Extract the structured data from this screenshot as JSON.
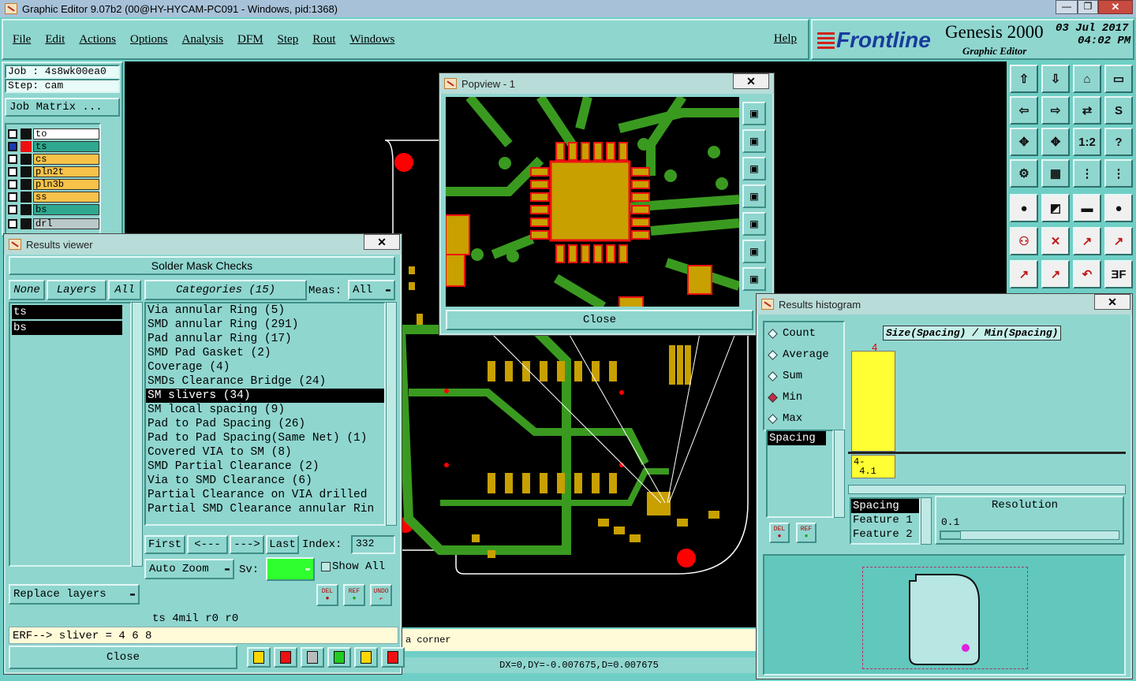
{
  "window": {
    "title": "Graphic Editor 9.07b2 (00@HY-HYCAM-PC091 - Windows, pid:1368)"
  },
  "menu": [
    "File",
    "Edit",
    "Actions",
    "Options",
    "Analysis",
    "DFM",
    "Step",
    "Rout",
    "Windows"
  ],
  "help": "Help",
  "brand": {
    "logo": "Frontline",
    "product": "Genesis 2000",
    "subtitle": "Graphic Editor",
    "date": "03 Jul 2017",
    "time": "04:02 PM"
  },
  "job": {
    "job_label": "Job : 4s8wk00ea0",
    "step_label": "Step: cam",
    "matrix_button": "Job Matrix ..."
  },
  "layers": [
    {
      "name": "to",
      "color": "#ffffff"
    },
    {
      "name": "ts",
      "color": "#2fa88f"
    },
    {
      "name": "cs",
      "color": "#f7c24a"
    },
    {
      "name": "pln2t",
      "color": "#f7c24a"
    },
    {
      "name": "pln3b",
      "color": "#f7c24a"
    },
    {
      "name": "ss",
      "color": "#f7c24a"
    },
    {
      "name": "bs",
      "color": "#2fa88f"
    },
    {
      "name": "drl",
      "color": "#b9c8c8"
    }
  ],
  "results_viewer": {
    "title": "Results viewer",
    "heading": "Solder Mask Checks",
    "none": "None",
    "layers_btn": "Layers",
    "all": "All",
    "categories_btn": "Categories (15)",
    "meas_label": "Meas:",
    "meas_value": "All",
    "layer_list": [
      "ts",
      "bs"
    ],
    "categories": [
      "Via annular Ring (5)",
      "SMD annular Ring (291)",
      "Pad annular Ring (17)",
      "SMD Pad Gasket (2)",
      "Coverage (4)",
      "SMDs Clearance Bridge (24)",
      "SM slivers (34)",
      "SM local spacing (9)",
      "Pad to Pad Spacing (26)",
      "Pad to Pad Spacing(Same Net) (1)",
      "Covered VIA to SM (8)",
      "SMD Partial Clearance (2)",
      "Via to SMD Clearance (6)",
      "Partial Clearance on VIA drilled",
      "Partial SMD Clearance annular Rin"
    ],
    "selected_index": 6,
    "first": "First",
    "prev": "<---",
    "next": "--->",
    "last": "Last",
    "index_label": "Index:",
    "index_value": "332",
    "auto_zoom": "Auto Zoom",
    "sv_label": "Sv:",
    "show_all": "Show All",
    "replace_layers": "Replace layers",
    "del": "DEL",
    "ref": "REF",
    "undo": "UNDO",
    "status": "ts 4mil  r0  r0",
    "erf": "ERF--> sliver = 4 6 8",
    "close": "Close"
  },
  "popview": {
    "title": "Popview - 1",
    "close": "Close"
  },
  "histogram": {
    "title": "Results histogram",
    "modes": [
      "Count",
      "Average",
      "Sum",
      "Min",
      "Max"
    ],
    "selected_mode": "Min",
    "chart_title": "Size(Spacing) / Min(Spacing)",
    "bar_label": "4",
    "bin_label": "4-\n 4.1",
    "measure_list": [
      "Spacing"
    ],
    "feature_list": [
      "Spacing",
      "Feature 1",
      "Feature 2"
    ],
    "resolution_label": "Resolution",
    "resolution_value": "0.1",
    "del": "DEL",
    "ref": "REF",
    "colors": {
      "bar": "#ffff33",
      "marker": "#e020e0"
    }
  },
  "canvas": {
    "corner_msg": "a corner",
    "coords": "DX=0,DY=-0.007675,D=0.007675"
  }
}
